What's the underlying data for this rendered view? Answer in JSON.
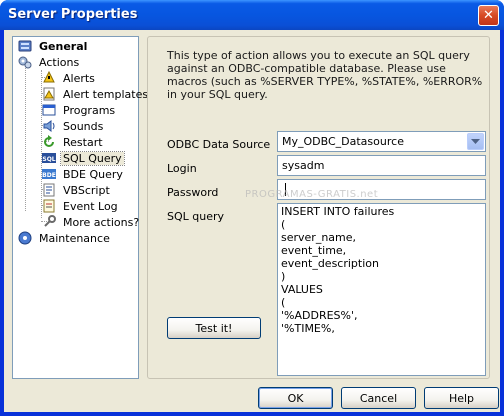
{
  "window": {
    "title": "Server Properties",
    "close_label": "✕"
  },
  "tree": {
    "items": [
      {
        "label": "General",
        "icon": "server-icon"
      },
      {
        "label": "Actions",
        "icon": "gears-icon"
      },
      {
        "label": "Alerts",
        "icon": "alert-icon"
      },
      {
        "label": "Alert templates",
        "icon": "alert-templates-icon"
      },
      {
        "label": "Programs",
        "icon": "programs-icon"
      },
      {
        "label": "Sounds",
        "icon": "sounds-icon"
      },
      {
        "label": "Restart",
        "icon": "restart-icon"
      },
      {
        "label": "SQL Query",
        "icon": "sql-icon",
        "badge": "SQL"
      },
      {
        "label": "BDE Query",
        "icon": "bde-icon",
        "badge": "BDE"
      },
      {
        "label": "VBScript",
        "icon": "vbscript-icon"
      },
      {
        "label": "Event Log",
        "icon": "event-log-icon"
      },
      {
        "label": "More actions?",
        "icon": "more-actions-icon"
      },
      {
        "label": "Maintenance",
        "icon": "maintenance-icon"
      }
    ]
  },
  "panel": {
    "description": "This type of action allows you to execute an SQL query against an ODBC-compatible database. Please use macros (such as %SERVER TYPE%, %STATE%, %ERROR% in your SQL query.",
    "odbc_label": "ODBC Data Source",
    "odbc_value": "My_ODBC_Datasource",
    "login_label": "Login",
    "login_value": "sysadm",
    "password_label": "Password",
    "password_value": "",
    "sql_label": "SQL query",
    "sql_lines": [
      "INSERT INTO failures",
      "(",
      "server_name,",
      "event_time,",
      "event_description",
      ")",
      "VALUES",
      "(",
      "'%ADDRES%',",
      "'%TIME%,"
    ],
    "test_button": "Test it!",
    "watermark": "PROGRAMAS-GRATIS.net"
  },
  "footer": {
    "ok": "OK",
    "cancel": "Cancel",
    "help": "Help"
  }
}
